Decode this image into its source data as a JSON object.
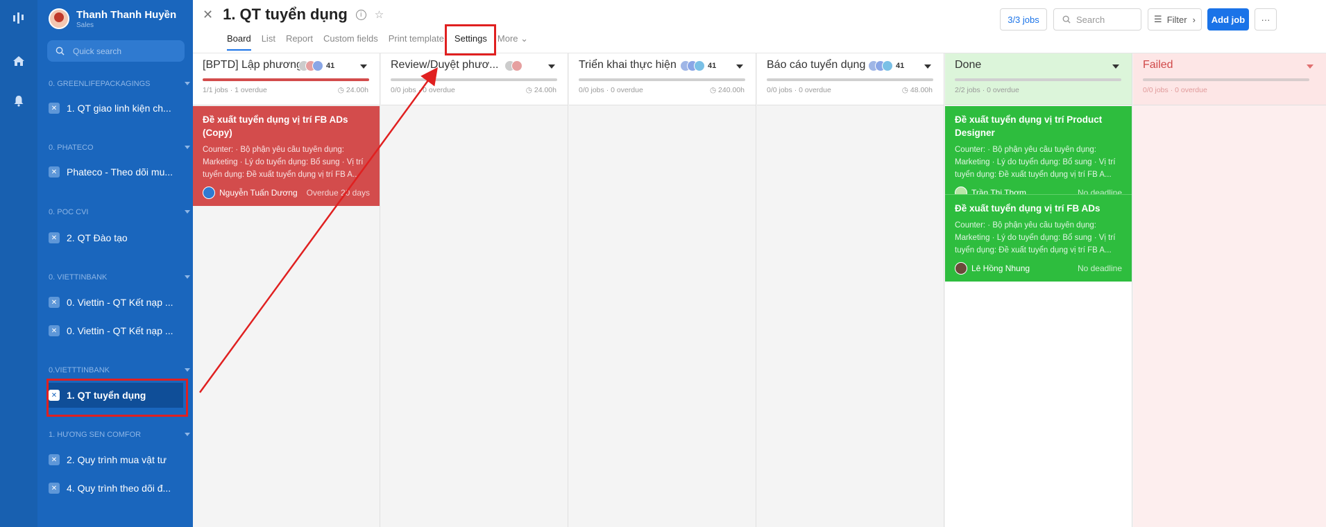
{
  "user": {
    "name": "Thanh Thanh Huyền",
    "role": "Sales"
  },
  "sidebar": {
    "search_placeholder": "Quick search",
    "groups": [
      {
        "label": "0. GREENLIFEPACKAGINGS",
        "items": [
          "1. QT giao linh kiện ch..."
        ]
      },
      {
        "label": "0. PHATECO",
        "items": [
          "Phateco - Theo dõi mu..."
        ]
      },
      {
        "label": "0. POC CVI",
        "items": [
          "2. QT Đào tạo"
        ]
      },
      {
        "label": "0. VIETTINBANK",
        "items": [
          "0. Viettin - QT Kết nạp ...",
          "0. Viettin - QT Kết nạp ..."
        ]
      },
      {
        "label": "0.VIETTTINBANK",
        "items": [
          "1. QT tuyển dụng"
        ]
      },
      {
        "label": "1. HƯƠNG SEN COMFOR",
        "items": [
          "2. Quy trình mua vật tư",
          "4. Quy trình theo dõi đ..."
        ]
      }
    ]
  },
  "header": {
    "title": "1. QT tuyển dụng",
    "tabs": [
      "Board",
      "List",
      "Report",
      "Custom fields",
      "Print template",
      "Settings",
      "More"
    ],
    "jobs_count": "3/3 jobs",
    "search_placeholder": "Search",
    "filter_label": "Filter",
    "add_job_label": "Add job",
    "more_label": "···"
  },
  "columns": [
    {
      "name": "[BPTD] Lập phương ...",
      "count": "41",
      "stat": "1/1 jobs · 1 overdue",
      "hours": "24.00h",
      "progress": 1.0,
      "bar_color": "#d34c4c"
    },
    {
      "name": "Review/Duyệt phươ...",
      "count": "",
      "stat": "0/0 jobs · 0 overdue",
      "hours": "24.00h",
      "progress": 0,
      "bar_color": "#d0d0d0"
    },
    {
      "name": "Triển khai thực hiện",
      "count": "41",
      "stat": "0/0 jobs · 0 overdue",
      "hours": "240.00h",
      "progress": 0,
      "bar_color": "#d0d0d0"
    },
    {
      "name": "Báo cáo tuyển dụng",
      "count": "41",
      "stat": "0/0 jobs · 0 overdue",
      "hours": "48.00h",
      "progress": 0,
      "bar_color": "#d0d0d0"
    },
    {
      "name": "Done",
      "count": "",
      "stat": "2/2 jobs · 0 overdue",
      "hours": "",
      "progress": 0,
      "bar_color": "#d0d0d0"
    },
    {
      "name": "Failed",
      "count": "",
      "stat": "0/0 jobs · 0 overdue",
      "hours": "",
      "progress": 0,
      "bar_color": "#d0d0d0"
    }
  ],
  "cards": [
    {
      "title": "Đề xuất tuyển dụng vị trí FB ADs (Copy)",
      "desc": "Counter: · Bộ phận yêu cầu tuyển dụng: Marketing · Lý do tuyển dụng: Bổ sung · Vị trí tuyển dụng: Đề xuất tuyển dụng vị trí FB A...",
      "assignee": "Nguyễn Tuấn Dương",
      "deadline": "Overdue 20 days"
    },
    {
      "title": "Đề xuất tuyển dụng vị trí Product Designer",
      "desc": "Counter: · Bộ phận yêu cầu tuyển dụng: Marketing · Lý do tuyển dụng: Bổ sung · Vị trí tuyển dụng: Đề xuất tuyển dụng vị trí FB A...",
      "assignee": "Trần Thị Thơm",
      "deadline": "No deadline"
    },
    {
      "title": "Đề xuất tuyển dụng vị trí FB ADs",
      "desc": "Counter: · Bộ phận yêu cầu tuyển dụng: Marketing · Lý do tuyển dụng: Bổ sung · Vị trí tuyển dụng: Đề xuất tuyển dụng vị trí FB A...",
      "assignee": "Lê Hồng Nhung",
      "deadline": "No deadline"
    }
  ],
  "colors": {
    "sidebar": "#1a66bd",
    "accent": "#1a73e8",
    "overdue_card": "#d34c4c",
    "done_card": "#2ebd3e",
    "annotation": "#e02020"
  },
  "icons": [
    "logo-icon",
    "home-icon",
    "bell-icon",
    "search-icon",
    "process-icon",
    "info-icon",
    "star-icon",
    "filter-icon",
    "chevron-right-icon"
  ]
}
